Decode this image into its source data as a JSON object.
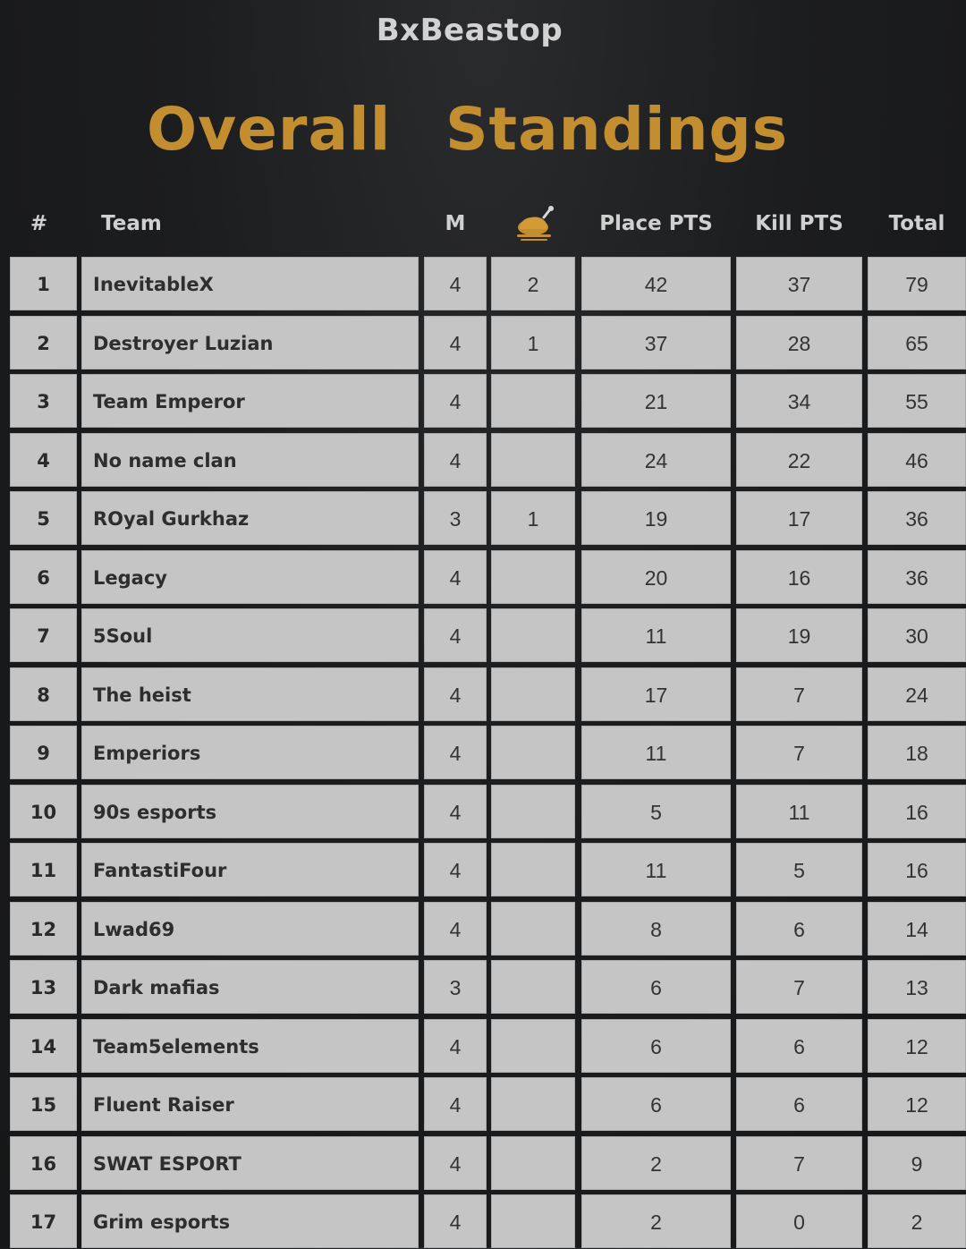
{
  "brand": "BxBeastop",
  "title": {
    "word1": "Overall",
    "word2": "Standings"
  },
  "accent_color": "#c38e2f",
  "headers": {
    "rank": "#",
    "team": "Team",
    "matches": "M",
    "chicken_icon": "chicken-dinner-icon",
    "place": "Place PTS",
    "kill": "Kill PTS",
    "total": "Total"
  },
  "rows": [
    {
      "rank": "1",
      "team": "InevitableX",
      "m": "4",
      "chicken": "2",
      "place": "42",
      "kill": "37",
      "total": "79"
    },
    {
      "rank": "2",
      "team": "Destroyer Luzian",
      "m": "4",
      "chicken": "1",
      "place": "37",
      "kill": "28",
      "total": "65"
    },
    {
      "rank": "3",
      "team": "Team Emperor",
      "m": "4",
      "chicken": "",
      "place": "21",
      "kill": "34",
      "total": "55"
    },
    {
      "rank": "4",
      "team": "No name clan",
      "m": "4",
      "chicken": "",
      "place": "24",
      "kill": "22",
      "total": "46"
    },
    {
      "rank": "5",
      "team": "ROyal Gurkhaz",
      "m": "3",
      "chicken": "1",
      "place": "19",
      "kill": "17",
      "total": "36"
    },
    {
      "rank": "6",
      "team": "Legacy",
      "m": "4",
      "chicken": "",
      "place": "20",
      "kill": "16",
      "total": "36"
    },
    {
      "rank": "7",
      "team": "5Soul",
      "m": "4",
      "chicken": "",
      "place": "11",
      "kill": "19",
      "total": "30"
    },
    {
      "rank": "8",
      "team": "The heist",
      "m": "4",
      "chicken": "",
      "place": "17",
      "kill": "7",
      "total": "24"
    },
    {
      "rank": "9",
      "team": "Emperiors",
      "m": "4",
      "chicken": "",
      "place": "11",
      "kill": "7",
      "total": "18"
    },
    {
      "rank": "10",
      "team": "90s esports",
      "m": "4",
      "chicken": "",
      "place": "5",
      "kill": "11",
      "total": "16"
    },
    {
      "rank": "11",
      "team": "FantastiFour",
      "m": "4",
      "chicken": "",
      "place": "11",
      "kill": "5",
      "total": "16"
    },
    {
      "rank": "12",
      "team": "Lwad69",
      "m": "4",
      "chicken": "",
      "place": "8",
      "kill": "6",
      "total": "14"
    },
    {
      "rank": "13",
      "team": "Dark mafias",
      "m": "3",
      "chicken": "",
      "place": "6",
      "kill": "7",
      "total": "13"
    },
    {
      "rank": "14",
      "team": "Team5elements",
      "m": "4",
      "chicken": "",
      "place": "6",
      "kill": "6",
      "total": "12"
    },
    {
      "rank": "15",
      "team": "Fluent Raiser",
      "m": "4",
      "chicken": "",
      "place": "6",
      "kill": "6",
      "total": "12"
    },
    {
      "rank": "16",
      "team": "SWAT ESPORT",
      "m": "4",
      "chicken": "",
      "place": "2",
      "kill": "7",
      "total": "9"
    },
    {
      "rank": "17",
      "team": "Grim esports",
      "m": "4",
      "chicken": "",
      "place": "2",
      "kill": "0",
      "total": "2"
    }
  ]
}
